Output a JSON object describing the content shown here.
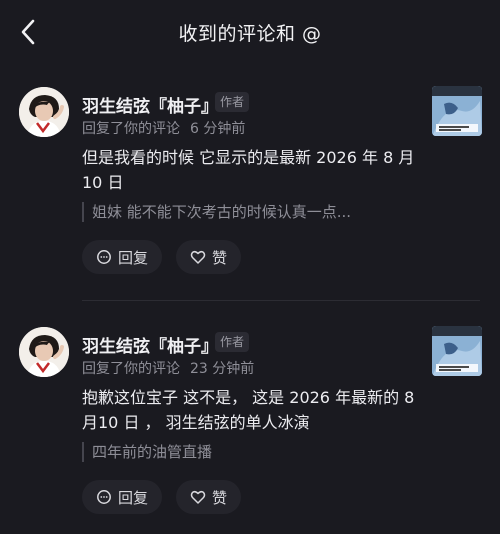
{
  "header": {
    "title": "收到的评论和 @"
  },
  "comments": [
    {
      "username": "羽生结弦『柚子』",
      "badge": "作者",
      "action_text": "回复了你的评论",
      "time": "6 分钟前",
      "text": "但是我看的时候 它显示的是最新 2026 年 8 月10 日",
      "quote": "姐妹 能不能下次考古的时候认真一点...",
      "reply_label": "回复",
      "like_label": "赞"
    },
    {
      "username": "羽生结弦『柚子』",
      "badge": "作者",
      "action_text": "回复了你的评论",
      "time": "23 分钟前",
      "text": "抱歉这位宝子 这不是， 这是 2026 年最新的 8 月10 日 ， 羽生结弦的单人冰演",
      "quote": "四年前的油管直播",
      "reply_label": "回复",
      "like_label": "赞"
    }
  ]
}
